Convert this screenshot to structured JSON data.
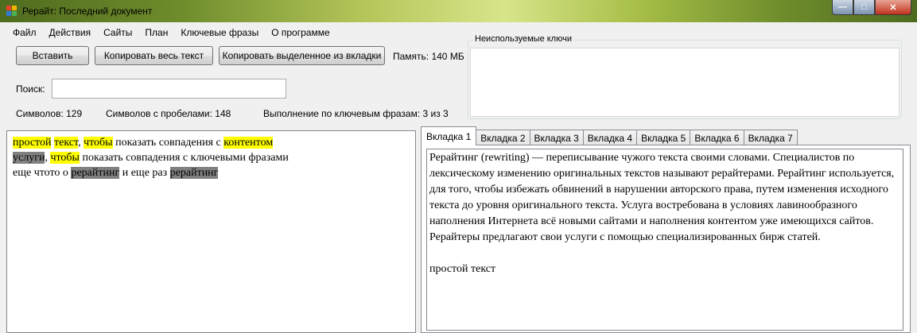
{
  "window": {
    "title": "Рерайт: Последний документ",
    "controls": {
      "minimize": "—",
      "maximize": "□",
      "close": "✕"
    }
  },
  "menu": [
    "Файл",
    "Действия",
    "Сайты",
    "План",
    "Ключевые фразы",
    "О программе"
  ],
  "toolbar": {
    "insert_label": "Вставить",
    "copy_all_label": "Копировать весь текст",
    "copy_selected_label": "Копировать выделенное из вкладки",
    "memory_label": "Память: 140 МБ"
  },
  "search": {
    "label": "Поиск:",
    "value": ""
  },
  "stats": {
    "chars": "Символов: 129",
    "chars_spaces": "Символов с пробелами: 148",
    "keywords": "Выполнение по ключевым фразам: 3 из 3"
  },
  "unused_keys": {
    "title": "Неиспользуемые ключи"
  },
  "editor": {
    "lines": [
      [
        {
          "t": "простой",
          "hl": "y"
        },
        {
          "t": " "
        },
        {
          "t": "текст",
          "hl": "y"
        },
        {
          "t": ", "
        },
        {
          "t": "чтобы",
          "hl": "y"
        },
        {
          "t": " показать совпадения с "
        },
        {
          "t": "контентом",
          "hl": "y"
        }
      ],
      [
        {
          "t": "услуги",
          "hl": "g"
        },
        {
          "t": ", "
        },
        {
          "t": "чтобы",
          "hl": "y"
        },
        {
          "t": " показать совпадения с ключевыми фразами"
        }
      ],
      [
        {
          "t": "еще чтото о "
        },
        {
          "t": "рерайтинг",
          "hl": "g"
        },
        {
          "t": " и еще раз "
        },
        {
          "t": "рерайтинг",
          "hl": "g"
        }
      ]
    ]
  },
  "tabs": [
    "Вкладка 1",
    "Вкладка 2",
    "Вкладка 3",
    "Вкладка 4",
    "Вкладка 5",
    "Вкладка 6",
    "Вкладка 7"
  ],
  "tab_content": {
    "paragraph1": "Рерайтинг (rewriting) — переписывание чужого текста своими словами. Специалистов по лексическому изменению оригинальных текстов называют рерайтерами. Рерайтинг используется, для того, чтобы избежать обвинений в нарушении авторского права, путем изменения исходного текста до уровня оригинального текста. Услуга востребована в условиях лавинообразного наполнения Интернета всё новыми сайтами и наполнения контентом уже имеющихся сайтов. Рерайтеры предлагают свои услуги с помощью специализированных бирж статей.",
    "paragraph2": "простой текст"
  },
  "colors": {
    "highlight_keyword": "#ffff00",
    "highlight_gray": "#808080",
    "window_bg": "#f0f0f0"
  }
}
